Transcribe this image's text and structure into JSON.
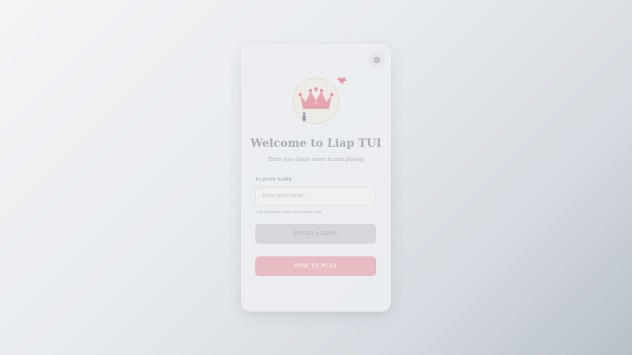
{
  "welcome": {
    "title": "Welcome to Liap TUI",
    "subtitle": "Enter your player name to start playing"
  },
  "settings": {
    "icon": "gear-icon",
    "glyph": "⚙"
  },
  "logo": {
    "crown_icon": "crown-icon",
    "figure_icon": "player-figure-icon",
    "bird_icon": "bird-icon",
    "crown_color": "#e69aa6"
  },
  "form": {
    "label": "PLAYER NAME",
    "placeholder": "Enter your name...",
    "value": "",
    "hint": "2-20 characters, letters and numbers only"
  },
  "buttons": {
    "enter_lobby": "ENTER LOBBY",
    "how_to_play": "HOW TO PLAY"
  },
  "colors": {
    "lobby_disabled": "#d5d7db",
    "how_to_play": "#e7bcc2",
    "title": "#a9adb5"
  }
}
